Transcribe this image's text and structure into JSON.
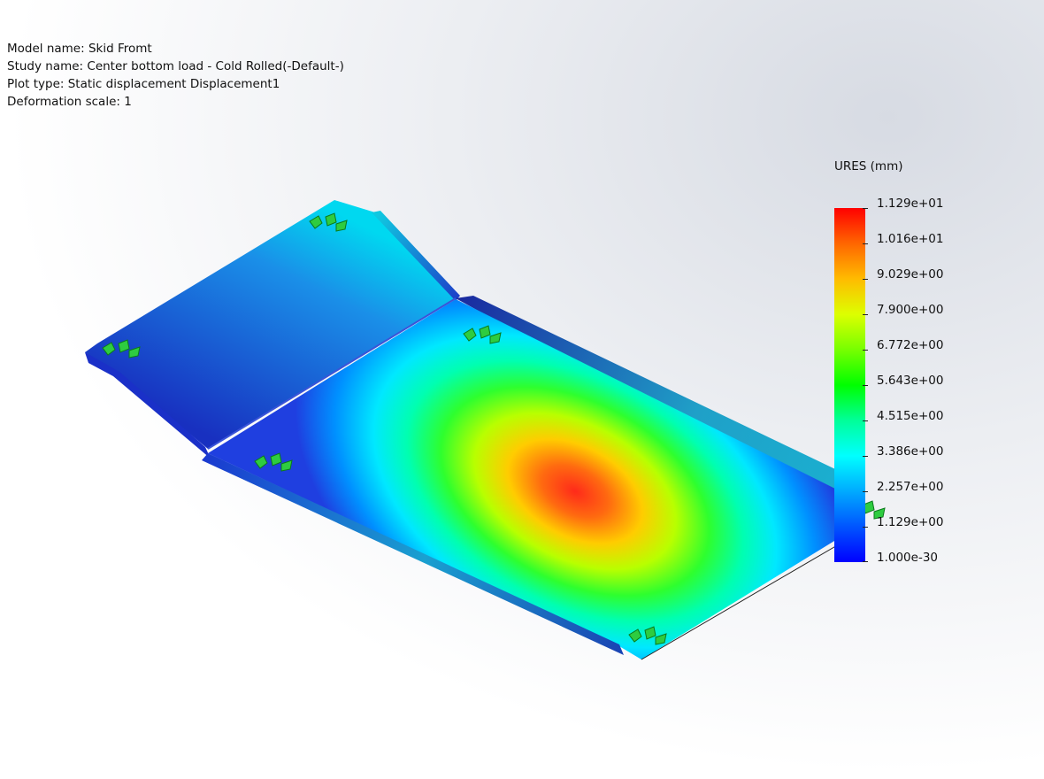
{
  "info": {
    "model_name": "Model name: Skid Fromt",
    "study_name": "Study name: Center bottom load - Cold Rolled(-Default-)",
    "plot_type": "Plot type: Static displacement Displacement1",
    "deformation_scale": "Deformation scale: 1"
  },
  "legend": {
    "title": "URES (mm)",
    "labels": [
      "1.129e+01",
      "1.016e+01",
      "9.029e+00",
      "7.900e+00",
      "6.772e+00",
      "5.643e+00",
      "4.515e+00",
      "3.386e+00",
      "2.257e+00",
      "1.129e+00",
      "1.000e-30"
    ]
  },
  "fixtures": {
    "icon": "fixed-geometry-icon",
    "count": 6
  },
  "colors": {
    "max": "#ff0000",
    "high": "#ffbb00",
    "mid": "#00ff00",
    "low": "#00ffff",
    "min": "#0000ff",
    "fixture": "#2ecc40"
  }
}
